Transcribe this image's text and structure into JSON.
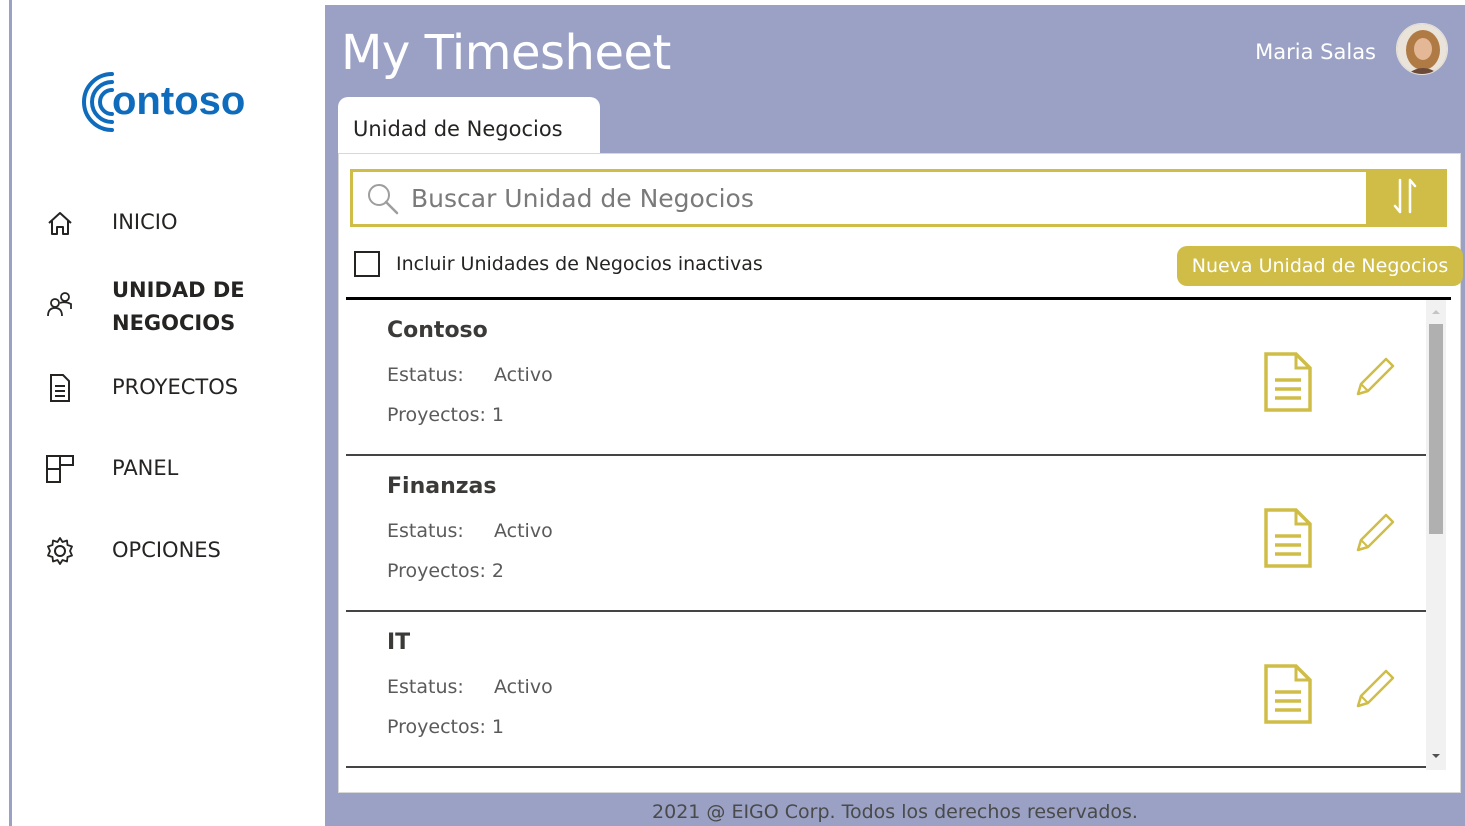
{
  "colors": {
    "accent": "#cfbd47",
    "header_bg": "#9aa1c5",
    "brand_blue": "#0f6cbd"
  },
  "brand": {
    "logo_text": "ontoso"
  },
  "sidebar": {
    "items": [
      {
        "label": "INICIO",
        "icon": "home-icon",
        "active": false
      },
      {
        "label": "UNIDAD DE NEGOCIOS",
        "icon": "people-icon",
        "active": true
      },
      {
        "label": "PROYECTOS",
        "icon": "document-icon",
        "active": false
      },
      {
        "label": "PANEL",
        "icon": "dashboard-icon",
        "active": false
      },
      {
        "label": "OPCIONES",
        "icon": "gear-icon",
        "active": false
      }
    ]
  },
  "header": {
    "title": "My Timesheet",
    "user_name": "Maria Salas"
  },
  "tab": {
    "label": "Unidad de Negocios"
  },
  "search": {
    "placeholder": "Buscar Unidad de Negocios",
    "value": ""
  },
  "filter": {
    "checkbox_label": "Incluir Unidades de Negocios inactivas",
    "checked": false
  },
  "actions": {
    "new_label": "Nueva Unidad de Negocios"
  },
  "list": {
    "status_label": "Estatus:",
    "rows": [
      {
        "name": "Contoso",
        "status": "Activo",
        "projects": "Proyectos: 1"
      },
      {
        "name": "Finanzas",
        "status": "Activo",
        "projects": "Proyectos: 2"
      },
      {
        "name": "IT",
        "status": "Activo",
        "projects": "Proyectos: 1"
      }
    ]
  },
  "footer": {
    "text": "2021 @ EIGO Corp. Todos los derechos reservados."
  }
}
